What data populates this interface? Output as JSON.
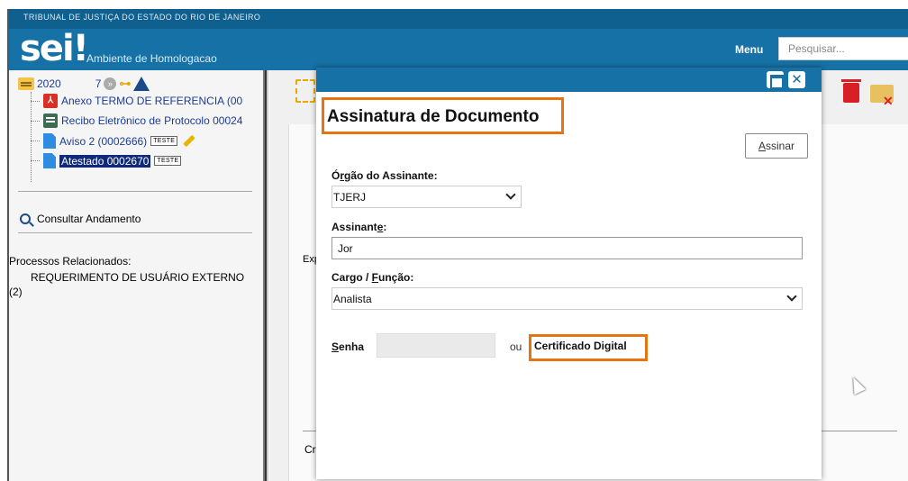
{
  "app": {
    "org_banner": "TRIBUNAL DE JUSTIÇA DO ESTADO DO RIO DE JANEIRO",
    "logo_text": "sei!",
    "environment": "Ambiente de Homologacao",
    "menu_label": "Menu",
    "search_placeholder": "Pesquisar..."
  },
  "tree": {
    "root_label": "2020",
    "root_suffix": "7",
    "items": [
      {
        "label": "Anexo TERMO DE REFERENCIA (00",
        "icon": "pdf-icon"
      },
      {
        "label": "Recibo Eletrônico de Protocolo 00024",
        "icon": "form-icon"
      },
      {
        "label": "Aviso 2 (0002666)",
        "icon": "document-icon",
        "badge": "TESTE",
        "pencil": true
      },
      {
        "label": "Atestado 0002670",
        "icon": "document-icon",
        "badge": "TESTE",
        "selected": true
      }
    ]
  },
  "sidebar": {
    "consult_label": "Consultar Andamento",
    "related_title": "Processos Relacionados:",
    "related_item": "REQUERIMENTO DE USUÁRIO EXTERNO (2)"
  },
  "rightpane": {
    "exp_text": "Expe",
    "cria_text": "Cria"
  },
  "modal": {
    "title": "Assinatura de Documento",
    "assinar_first": "A",
    "assinar_rest": "ssinar",
    "orgao_label_a": "Ó",
    "orgao_label_acc": "r",
    "orgao_label_b": "gão do Assinante:",
    "orgao_value": "TJERJ",
    "assinante_label_a": "Assinant",
    "assinante_label_acc": "e",
    "assinante_label_b": ":",
    "assinante_value": "Jor",
    "cargo_label_a": "Cargo / ",
    "cargo_label_acc": "F",
    "cargo_label_b": "unção:",
    "cargo_value": "Analista",
    "senha_acc": "S",
    "senha_rest": "enha",
    "ou": "ou",
    "certificado": "Certificado Digital"
  },
  "colors": {
    "header_blue": "#1672a6",
    "highlight_orange": "#e8740f",
    "trash_red": "#d81f26"
  }
}
